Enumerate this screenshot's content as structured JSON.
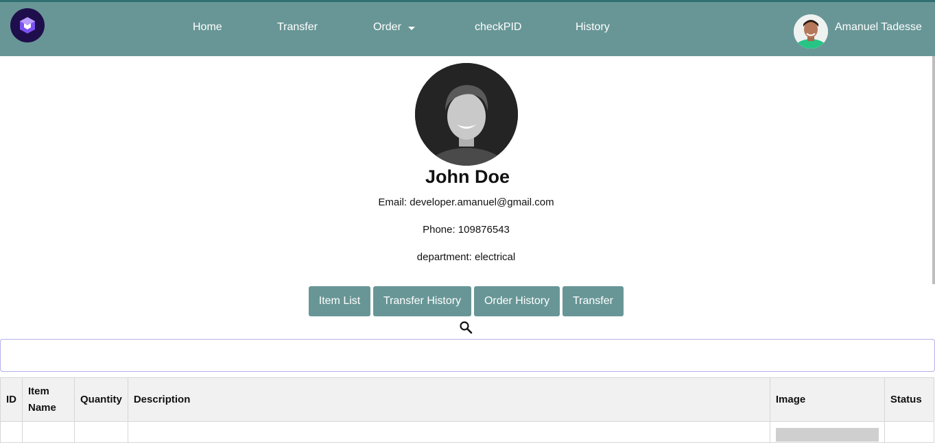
{
  "nav": {
    "items": [
      {
        "label": "Home"
      },
      {
        "label": "Transfer"
      },
      {
        "label": "Order"
      },
      {
        "label": "checkPID"
      },
      {
        "label": "History"
      }
    ],
    "user_name": "Amanuel Tadesse",
    "logo_icon": "cube-logo-icon",
    "colors": {
      "navbar": "#689696",
      "accent": "#2f6f72",
      "logo_bg": "#1f0e4c"
    }
  },
  "profile": {
    "name": "John Doe",
    "email_line": "Email: developer.amanuel@gmail.com",
    "phone_line": "Phone: 109876543",
    "department_line": "department: electrical"
  },
  "actions": {
    "item_list": "Item List",
    "transfer_history": "Transfer History",
    "order_history": "Order History",
    "transfer": "Transfer"
  },
  "search": {
    "icon": "search-icon",
    "value": "",
    "placeholder": ""
  },
  "table": {
    "headers": [
      "ID",
      "Item Name",
      "Quantity",
      "Description",
      "Image",
      "Status"
    ]
  }
}
